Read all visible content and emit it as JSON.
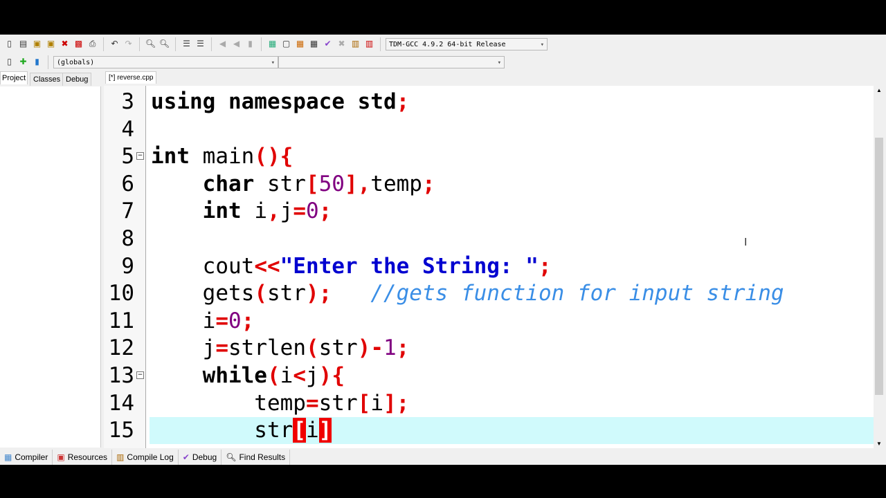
{
  "toolbar": {
    "compiler_select": "TDM-GCC 4.9.2 64-bit Release",
    "scope_select": "(globals)",
    "member_select": ""
  },
  "left_tabs": [
    "Project",
    "Classes",
    "Debug"
  ],
  "file_tab": "[*] reverse.cpp",
  "bottom_tabs": [
    "Compiler",
    "Resources",
    "Compile Log",
    "Debug",
    "Find Results"
  ],
  "editor": {
    "current_line": 15,
    "lines": [
      {
        "n": "3",
        "tokens": [
          [
            "using namespace std",
            "k"
          ],
          [
            ";",
            "p"
          ]
        ]
      },
      {
        "n": "4",
        "tokens": []
      },
      {
        "n": "5",
        "fold": true,
        "tokens": [
          [
            "int",
            "k"
          ],
          [
            " main",
            ""
          ],
          [
            "(){",
            "p"
          ]
        ]
      },
      {
        "n": "6",
        "tokens": [
          [
            "    ",
            ""
          ],
          [
            "char",
            "k"
          ],
          [
            " str",
            ""
          ],
          [
            "[",
            "p"
          ],
          [
            "50",
            "n"
          ],
          [
            "],",
            "p"
          ],
          [
            "temp",
            ""
          ],
          [
            ";",
            "p"
          ]
        ]
      },
      {
        "n": "7",
        "tokens": [
          [
            "    ",
            ""
          ],
          [
            "int",
            "k"
          ],
          [
            " i",
            ""
          ],
          [
            ",",
            "p"
          ],
          [
            "j",
            ""
          ],
          [
            "=",
            "p"
          ],
          [
            "0",
            "n"
          ],
          [
            ";",
            "p"
          ]
        ]
      },
      {
        "n": "8",
        "tokens": []
      },
      {
        "n": "9",
        "tokens": [
          [
            "    cout",
            ""
          ],
          [
            "<<",
            "p"
          ],
          [
            "\"Enter the String: \"",
            "s"
          ],
          [
            ";",
            "p"
          ]
        ]
      },
      {
        "n": "10",
        "tokens": [
          [
            "    gets",
            ""
          ],
          [
            "(",
            "p"
          ],
          [
            "str",
            ""
          ],
          [
            ");",
            "p"
          ],
          [
            "   ",
            ""
          ],
          [
            "//gets function for input string",
            "cm"
          ]
        ]
      },
      {
        "n": "11",
        "tokens": [
          [
            "    i",
            ""
          ],
          [
            "=",
            "p"
          ],
          [
            "0",
            "n"
          ],
          [
            ";",
            "p"
          ]
        ]
      },
      {
        "n": "12",
        "tokens": [
          [
            "    j",
            ""
          ],
          [
            "=",
            "p"
          ],
          [
            "strlen",
            ""
          ],
          [
            "(",
            "p"
          ],
          [
            "str",
            ""
          ],
          [
            ")-",
            "p"
          ],
          [
            "1",
            "n"
          ],
          [
            ";",
            "p"
          ]
        ]
      },
      {
        "n": "13",
        "fold": true,
        "tokens": [
          [
            "    ",
            ""
          ],
          [
            "while",
            "k"
          ],
          [
            "(",
            "p"
          ],
          [
            "i",
            ""
          ],
          [
            "<",
            "p"
          ],
          [
            "j",
            ""
          ],
          [
            "){",
            "p"
          ]
        ]
      },
      {
        "n": "14",
        "tokens": [
          [
            "        temp",
            ""
          ],
          [
            "=",
            "p"
          ],
          [
            "str",
            ""
          ],
          [
            "[",
            "p"
          ],
          [
            "i",
            ""
          ],
          [
            "];",
            "p"
          ]
        ]
      },
      {
        "n": "15",
        "tokens": [
          [
            "        str",
            ""
          ],
          [
            "[",
            "b"
          ],
          [
            "i",
            ""
          ],
          [
            "]",
            "b"
          ]
        ]
      }
    ]
  }
}
